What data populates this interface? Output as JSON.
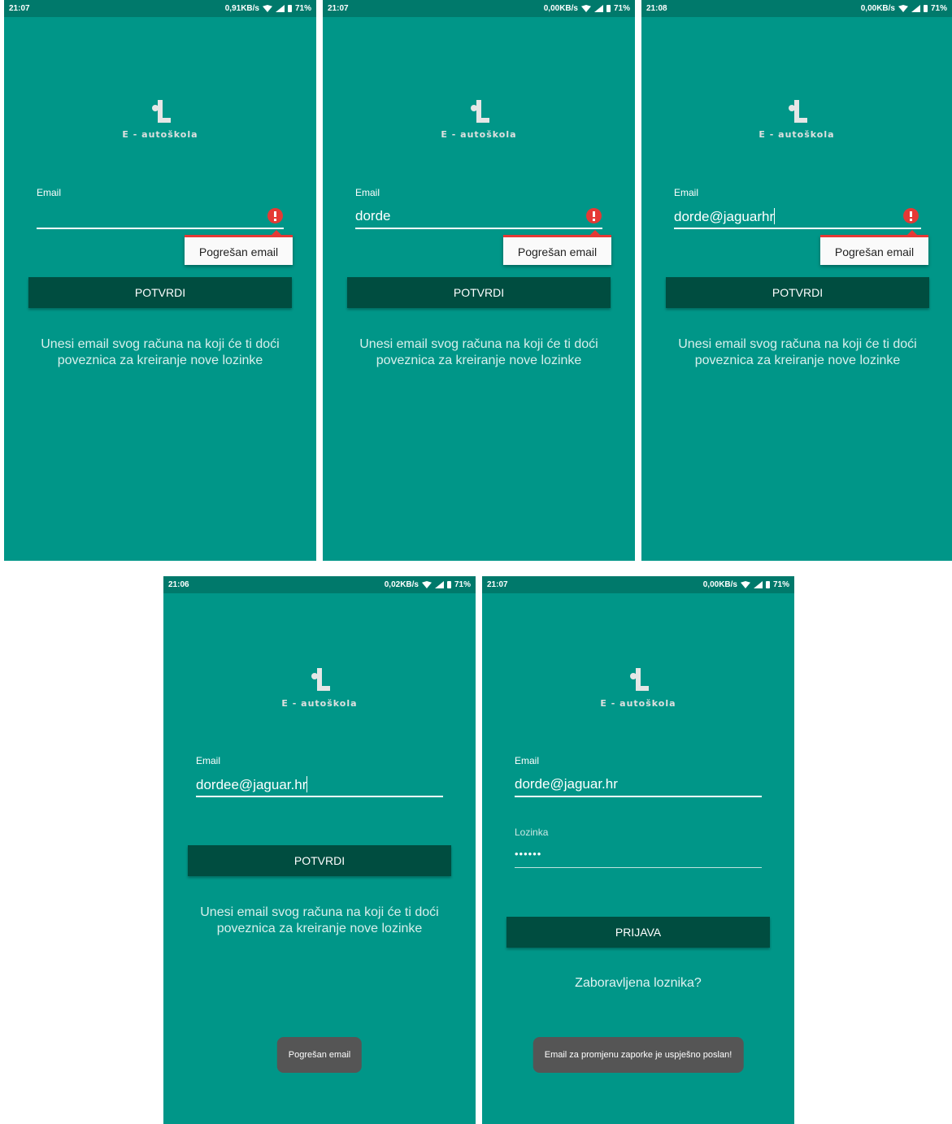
{
  "app": {
    "logo_text": "E - autoškola"
  },
  "colors": {
    "background": "#009688",
    "statusbar": "#00796B",
    "button": "#004D40",
    "error": "#E53935",
    "toast": "#555555"
  },
  "screens": [
    {
      "status": {
        "time": "21:07",
        "speed": "0,91KB/s",
        "battery": "71%"
      },
      "email": {
        "label": "Email",
        "value": ""
      },
      "error": "Pogrešan email",
      "button": "POTVRDI",
      "hint": "Unesi email svog računa na koji će ti doći poveznica za kreiranje nove lozinke"
    },
    {
      "status": {
        "time": "21:07",
        "speed": "0,00KB/s",
        "battery": "71%"
      },
      "email": {
        "label": "Email",
        "value": "dorde"
      },
      "error": "Pogrešan email",
      "button": "POTVRDI",
      "hint": "Unesi email svog računa na koji će ti doći poveznica za kreiranje nove lozinke"
    },
    {
      "status": {
        "time": "21:08",
        "speed": "0,00KB/s",
        "battery": "71%"
      },
      "email": {
        "label": "Email",
        "value": "dorde@jaguarhr"
      },
      "error": "Pogrešan email",
      "button": "POTVRDI",
      "hint": "Unesi email svog računa na koji će ti doći poveznica za kreiranje nove lozinke"
    },
    {
      "status": {
        "time": "21:06",
        "speed": "0,02KB/s",
        "battery": "71%"
      },
      "email": {
        "label": "Email",
        "value": "dordee@jaguar.hr"
      },
      "button": "POTVRDI",
      "hint": "Unesi email svog računa na koji će ti doći poveznica za kreiranje nove lozinke",
      "toast": "Pogrešan email"
    },
    {
      "status": {
        "time": "21:07",
        "speed": "0,00KB/s",
        "battery": "71%"
      },
      "email": {
        "label": "Email",
        "value": "dorde@jaguar.hr"
      },
      "password": {
        "label": "Lozinka",
        "value": "••••••"
      },
      "button": "PRIJAVA",
      "link": "Zaboravljena loznika?",
      "toast": "Email za promjenu zaporke je uspješno poslan!"
    }
  ]
}
